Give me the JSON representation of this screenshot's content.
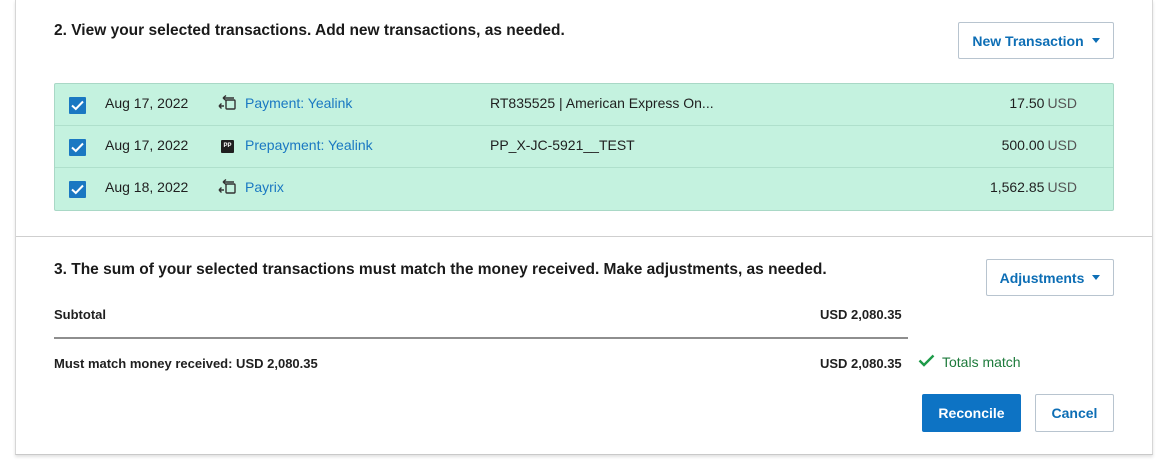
{
  "section2": {
    "heading": "2. View your selected transactions. Add new transactions, as needed.",
    "new_transaction_label": "New Transaction"
  },
  "transactions": [
    {
      "checked": true,
      "date": "Aug 17, 2022",
      "icon": "payment-transfer-icon",
      "name": "Payment: Yealink",
      "reference": "RT835525 | American Express On...",
      "amount": "17.50",
      "currency": "USD"
    },
    {
      "checked": true,
      "date": "Aug 17, 2022",
      "icon": "prepayment-badge-icon",
      "icon_text": "PP",
      "name": "Prepayment: Yealink",
      "reference": "PP_X-JC-5921__TEST",
      "amount": "500.00",
      "currency": "USD"
    },
    {
      "checked": true,
      "date": "Aug 18, 2022",
      "icon": "payment-transfer-icon",
      "name": "Payrix",
      "reference": "",
      "amount": "1,562.85",
      "currency": "USD"
    }
  ],
  "section3": {
    "heading": "3. The sum of your selected transactions must match the money received. Make adjustments, as needed.",
    "adjustments_label": "Adjustments",
    "subtotal_label": "Subtotal",
    "subtotal_value": "USD 2,080.35",
    "must_match_label": "Must match money received: USD 2,080.35",
    "must_match_value": "USD 2,080.35",
    "match_status": "Totals match"
  },
  "actions": {
    "reconcile_label": "Reconcile",
    "cancel_label": "Cancel"
  },
  "colors": {
    "accent": "#0d73c4",
    "selected_row_bg": "#c4f2df",
    "success": "#1d7a3b"
  }
}
